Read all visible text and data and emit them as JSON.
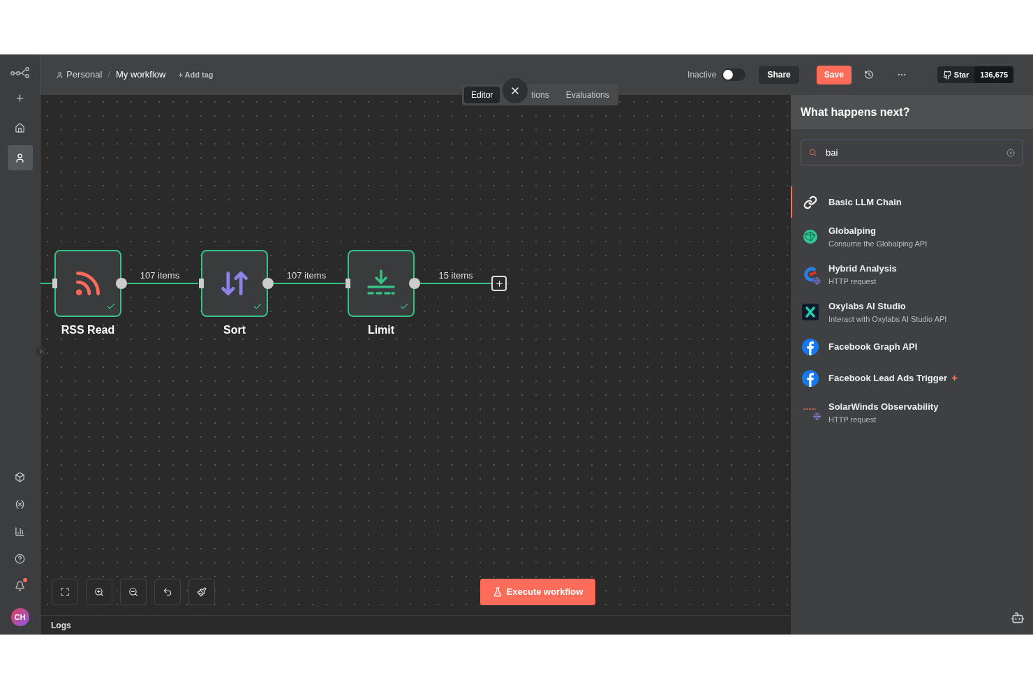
{
  "sidebar": {
    "items": [
      {
        "kind": "add",
        "selected": false
      },
      {
        "kind": "home",
        "selected": false
      },
      {
        "kind": "person",
        "selected": true
      }
    ],
    "bottom_items": [
      {
        "kind": "cube",
        "has_notification": false
      },
      {
        "kind": "variables",
        "has_notification": false
      },
      {
        "kind": "chart",
        "has_notification": false
      },
      {
        "kind": "help",
        "has_notification": false
      },
      {
        "kind": "bell",
        "has_notification": true
      }
    ],
    "avatar": "CH"
  },
  "header": {
    "breadcrumb": [
      "Personal",
      "My workflow"
    ],
    "separator": "/",
    "add_tag": "+ Add tag",
    "toggle": {
      "label": "Inactive",
      "on": false
    },
    "share": "Share",
    "save": "Save",
    "github": {
      "label": "Star",
      "count": "136,675"
    }
  },
  "tabs": [
    {
      "label": "Editor",
      "selected": true
    },
    {
      "label": "tions",
      "selected": false
    },
    {
      "label": "Evaluations",
      "selected": false
    }
  ],
  "nodes": [
    {
      "name": "RSS Read",
      "kind": "rss",
      "success": true,
      "output_label": "107 items"
    },
    {
      "name": "Sort",
      "kind": "sort",
      "success": true,
      "output_label": "107 items"
    },
    {
      "name": "Limit",
      "kind": "limit",
      "success": true,
      "output_label": "15 items"
    }
  ],
  "execute_button": "Execute workflow",
  "logs": "Logs",
  "panel": {
    "title": "What happens next?",
    "search": {
      "value": "bai"
    },
    "results": [
      {
        "name": "Basic LLM Chain",
        "kind": "chain",
        "selected": true,
        "flagged": false
      },
      {
        "name": "Globalping",
        "description": "Consume the Globalping API",
        "kind": "globalping",
        "selected": false,
        "flagged": false
      },
      {
        "name": "Hybrid Analysis",
        "description": "HTTP request",
        "kind": "hybrid",
        "selected": false,
        "flagged": false
      },
      {
        "name": "Oxylabs AI Studio",
        "description": "Interact with Oxylabs AI Studio API",
        "kind": "oxylabs",
        "selected": false,
        "flagged": false
      },
      {
        "name": "Facebook Graph API",
        "kind": "facebook",
        "selected": false,
        "flagged": false
      },
      {
        "name": "Facebook Lead Ads Trigger",
        "kind": "facebook",
        "selected": false,
        "flagged": true
      },
      {
        "name": "SolarWinds Observability",
        "description": "HTTP request",
        "kind": "solarwinds",
        "selected": false,
        "flagged": false
      }
    ]
  }
}
